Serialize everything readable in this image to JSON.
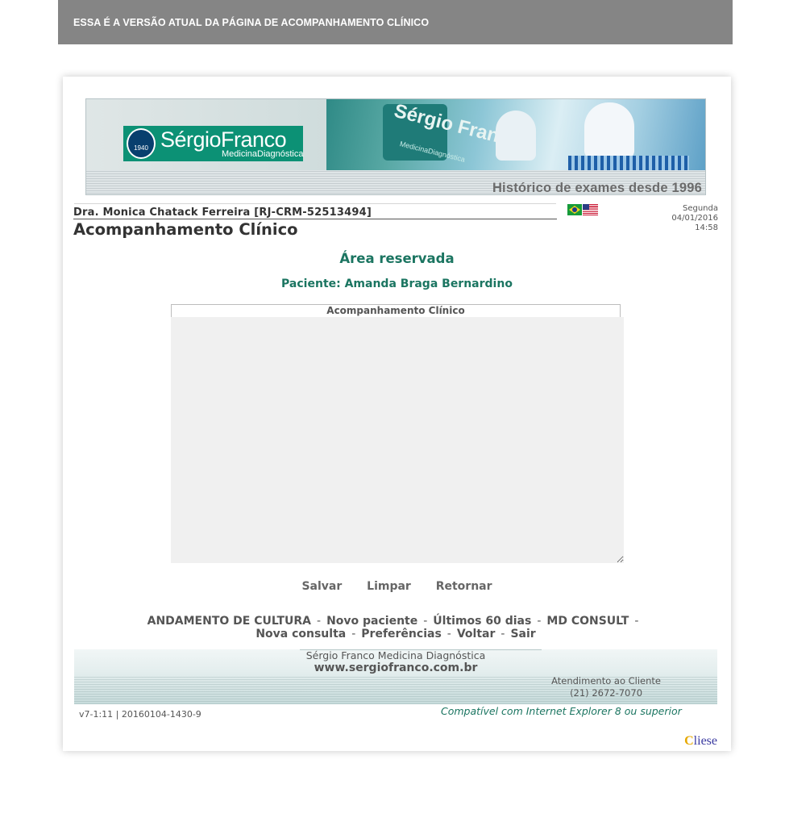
{
  "banner": {
    "notice": "ESSA É A VERSÃO ATUAL DA PÁGINA DE ACOMPANHAMENTO CLÍNICO"
  },
  "header": {
    "logo_name": "SérgioFranco",
    "logo_sub": "MedicinaDiagnóstica",
    "logo_year": "1940",
    "watermark": "Sérgio Franco",
    "tagline": "Histórico de exames desde 1996"
  },
  "user": {
    "doctor": "Dra. Monica Chatack Ferreira [RJ-CRM-52513494]"
  },
  "page": {
    "title": "Acompanhamento Clínico"
  },
  "languages": [
    {
      "name": "brazil-flag-icon"
    },
    {
      "name": "usa-flag-icon"
    }
  ],
  "datetime": {
    "weekday": "Segunda",
    "date": "04/01/2016",
    "time": "14:58"
  },
  "content": {
    "area_title": "Área reservada",
    "patient": "Paciente: Amanda Braga Bernardino",
    "field_label": "Acompanhamento Clínico",
    "notes_value": ""
  },
  "actions": {
    "save": "Salvar",
    "clear": "Limpar",
    "back": "Retornar"
  },
  "nav": [
    "ANDAMENTO DE CULTURA",
    "Novo paciente",
    "Últimos 60 dias",
    "MD CONSULT",
    "Nova consulta",
    "Preferências",
    "Voltar",
    "Sair"
  ],
  "footer": {
    "company": "Sérgio Franco Medicina Diagnóstica",
    "website": "www.sergiofranco.com.br",
    "service_label": "Atendimento ao Cliente",
    "service_phone": "(21) 2672-7070"
  },
  "meta": {
    "version": "v7-1:11 | 20160104-1430-9",
    "compat": "Compatível com Internet Explorer 8 ou superior",
    "brand_first": "C",
    "brand_rest": "liese"
  },
  "colors": {
    "accent": "#1b7561",
    "banner": "#858585",
    "logo_bg": "#0c9175"
  }
}
